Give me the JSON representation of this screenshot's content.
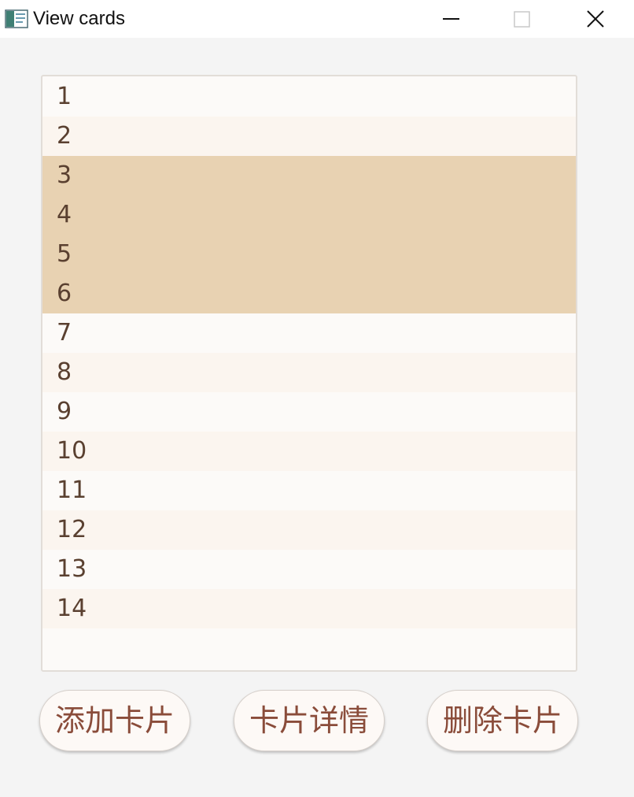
{
  "window": {
    "title": "View cards",
    "icon": "app-window-icon",
    "controls": [
      "minimize-icon",
      "maximize-icon",
      "close-icon"
    ]
  },
  "list": {
    "items": [
      "1",
      "2",
      "3",
      "4",
      "5",
      "6",
      "7",
      "8",
      "9",
      "10",
      "11",
      "12",
      "13",
      "14"
    ],
    "selected": [
      "3",
      "4",
      "5",
      "6"
    ]
  },
  "buttons": {
    "add_label": "添加卡片",
    "detail_label": "卡片详情",
    "delete_label": "删除卡片"
  },
  "colors": {
    "selection": "#e8d2b2",
    "text": "#5a4030",
    "button_text": "#8a4c3a"
  }
}
